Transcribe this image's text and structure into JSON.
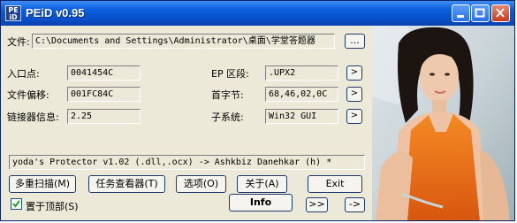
{
  "window": {
    "title": "PEiD v0.95",
    "icon_text": "PE iD"
  },
  "file": {
    "label": "文件:",
    "value": "C:\\Documents and Settings\\Administrator\\桌面\\学堂答题器",
    "browse_label": "..."
  },
  "fields": {
    "entry_point_label": "入口点:",
    "entry_point": "0041454C",
    "file_offset_label": "文件偏移:",
    "file_offset": "001FC84C",
    "linker_label": "链接器信息:",
    "linker": "2.25",
    "ep_section_label": "EP 区段:",
    "ep_section": ".UPX2",
    "first_bytes_label": "首字节:",
    "first_bytes": "68,46,02,0C",
    "subsystem_label": "子系统:",
    "subsystem": "Win32 GUI",
    "arrow_label": ">"
  },
  "result": "yoda's Protector v1.02 (.dll,.ocx) -> Ashkbiz Danehkar (h) *",
  "buttons": {
    "multi_scan": "多重扫描(M)",
    "task_viewer": "任务查看器(T)",
    "options": "选项(O)",
    "about": "关于(A)",
    "exit": "Exit",
    "info": "Info",
    "forward": ">>",
    "more": "->"
  },
  "stay_on_top": {
    "label": "置于顶部(S)",
    "checked": true
  },
  "colors": {
    "titlebar": "#0a4fc9",
    "face": "#ece9d8",
    "dress": "#f07a1c"
  }
}
